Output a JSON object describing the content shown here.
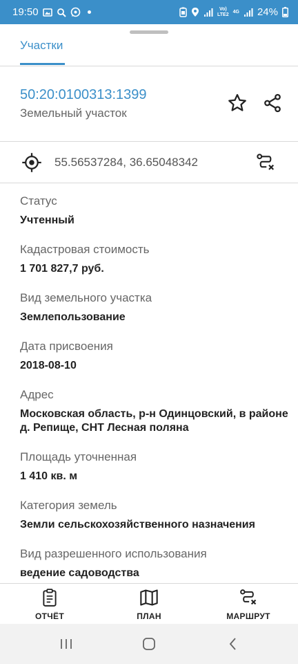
{
  "status_bar": {
    "time": "19:50",
    "battery": "24%",
    "network_top": "Vo)",
    "network_bottom": "LTE2",
    "network_gen": "4G"
  },
  "tabs": [
    {
      "label": "Участки"
    }
  ],
  "parcel": {
    "cadastral_number": "50:20:0100313:1399",
    "type": "Земельный участок",
    "coordinates": "55.56537284, 36.65048342"
  },
  "fields": [
    {
      "label": "Статус",
      "value": "Учтенный"
    },
    {
      "label": "Кадастровая стоимость",
      "value": "1 701 827,7 руб."
    },
    {
      "label": "Вид земельного участка",
      "value": "Землепользование"
    },
    {
      "label": "Дата присвоения",
      "value": "2018-08-10"
    },
    {
      "label": "Адрес",
      "value": "Московская область, р-н Одинцовский, в районе д. Репище, СНТ Лесная поляна"
    },
    {
      "label": "Площадь уточненная",
      "value": "1 410 кв. м"
    },
    {
      "label": "Категория земель",
      "value": "Земли сельскохозяйственного назначения"
    },
    {
      "label": "Вид разрешенного использования",
      "value": "ведение садоводства"
    }
  ],
  "bottom_nav": {
    "report": "ОТЧЁТ",
    "plan": "ПЛАН",
    "route": "МАРШРУТ"
  },
  "colors": {
    "accent": "#3b8fc9",
    "text_primary": "#222222",
    "text_secondary": "#666666"
  },
  "icons": [
    "image-icon",
    "search-icon",
    "whatsapp-icon",
    "battery-saver-icon",
    "location-icon",
    "signal-icon",
    "battery-icon",
    "star-icon",
    "share-icon",
    "crosshair-icon",
    "route-cancel-icon",
    "clipboard-icon",
    "map-icon",
    "recent-apps-icon",
    "home-icon",
    "back-icon"
  ]
}
